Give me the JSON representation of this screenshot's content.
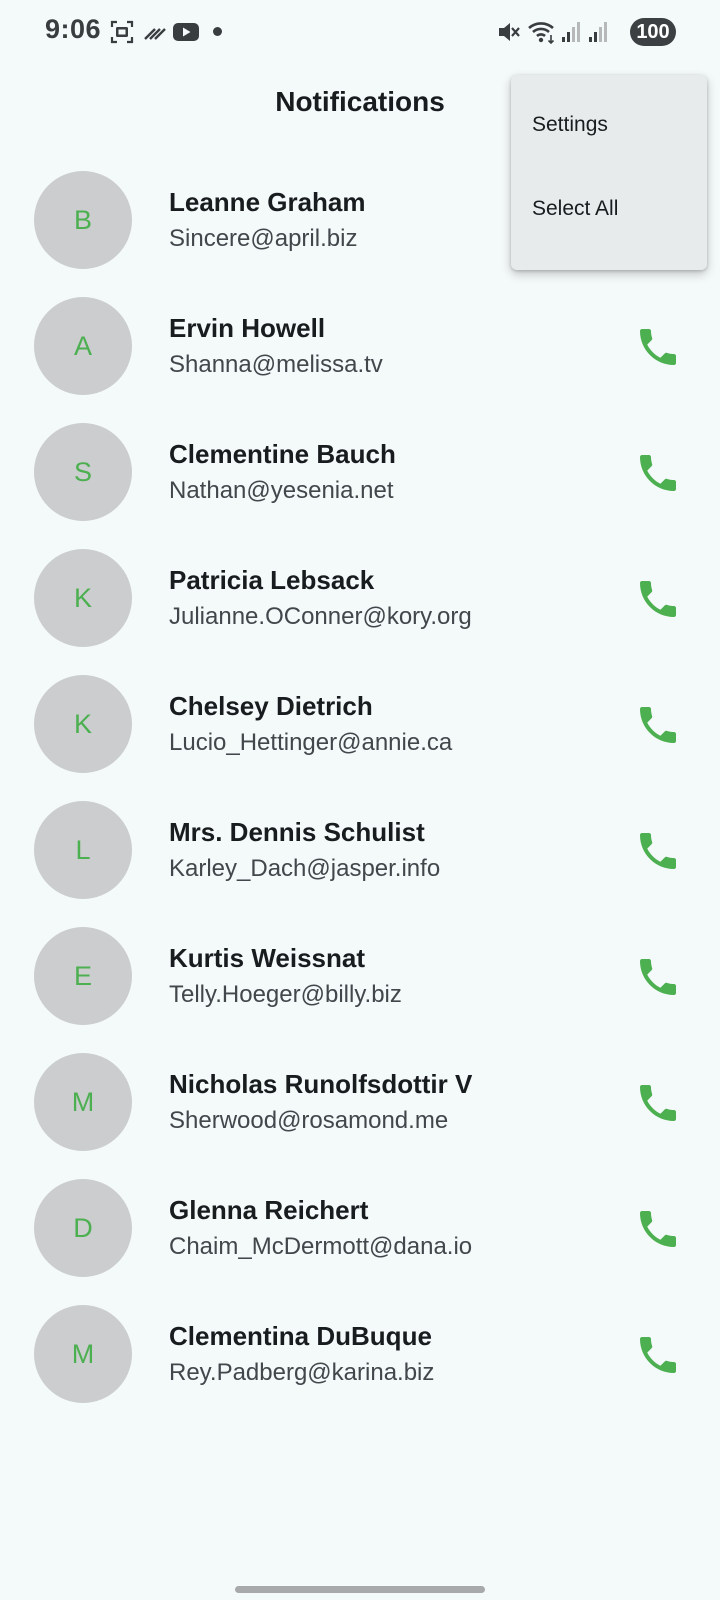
{
  "status_bar": {
    "time": "9:06",
    "battery": "100",
    "icons": [
      "screenshot-icon",
      "tool-icon",
      "youtube-icon",
      "notification-dot-icon",
      "mute-icon",
      "wifi-icon",
      "signal-icon",
      "signal-icon",
      "battery-icon"
    ]
  },
  "app_bar": {
    "title": "Notifications"
  },
  "menu": {
    "items": [
      {
        "label": "Settings"
      },
      {
        "label": "Select All"
      }
    ]
  },
  "contacts": [
    {
      "initial": "B",
      "name": "Leanne Graham",
      "email": "Sincere@april.biz"
    },
    {
      "initial": "A",
      "name": "Ervin Howell",
      "email": "Shanna@melissa.tv"
    },
    {
      "initial": "S",
      "name": "Clementine Bauch",
      "email": "Nathan@yesenia.net"
    },
    {
      "initial": "K",
      "name": "Patricia Lebsack",
      "email": "Julianne.OConner@kory.org"
    },
    {
      "initial": "K",
      "name": "Chelsey Dietrich",
      "email": "Lucio_Hettinger@annie.ca"
    },
    {
      "initial": "L",
      "name": "Mrs. Dennis Schulist",
      "email": "Karley_Dach@jasper.info"
    },
    {
      "initial": "E",
      "name": "Kurtis Weissnat",
      "email": "Telly.Hoeger@billy.biz"
    },
    {
      "initial": "M",
      "name": "Nicholas Runolfsdottir V",
      "email": "Sherwood@rosamond.me"
    },
    {
      "initial": "D",
      "name": "Glenna Reichert",
      "email": "Chaim_McDermott@dana.io"
    },
    {
      "initial": "M",
      "name": "Clementina DuBuque",
      "email": "Rey.Padberg@karina.biz"
    }
  ],
  "colors": {
    "background": "#f4f9fa",
    "accent_green": "#4caf50",
    "avatar_bg": "#cbcdcf",
    "menu_bg": "#e7ebec"
  }
}
